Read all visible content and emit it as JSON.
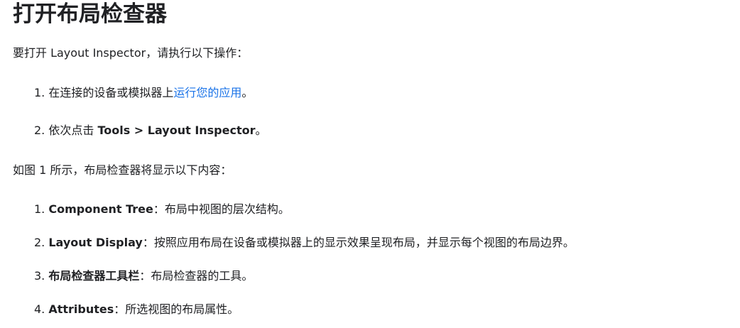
{
  "heading": "打开布局检查器",
  "intro": {
    "before": "要打开 Layout Inspector，请执行以下操作："
  },
  "steps": [
    {
      "number": "1.",
      "text_before": " 在连接的设备或模拟器上",
      "link": "运行您的应用",
      "text_after": "。"
    },
    {
      "number": "2.",
      "text_before": " 依次点击 ",
      "bold": "Tools > Layout Inspector",
      "text_after": "。"
    }
  ],
  "figure_intro": "如图 1 所示，布局检查器将显示以下内容：",
  "contents": [
    {
      "number": "1.",
      "bold": "Component Tree",
      "text": "：布局中视图的层次结构。"
    },
    {
      "number": "2.",
      "bold": "Layout Display",
      "text": "：按照应用布局在设备或模拟器上的显示效果呈现布局，并显示每个视图的布局边界。"
    },
    {
      "number": "3.",
      "bold": "布局检查器工具栏",
      "text": "：布局检查器的工具。"
    },
    {
      "number": "4.",
      "bold": "Attributes",
      "text": "：所选视图的布局属性。"
    }
  ],
  "colors": {
    "text": "#202124",
    "link": "#1a73e8"
  }
}
